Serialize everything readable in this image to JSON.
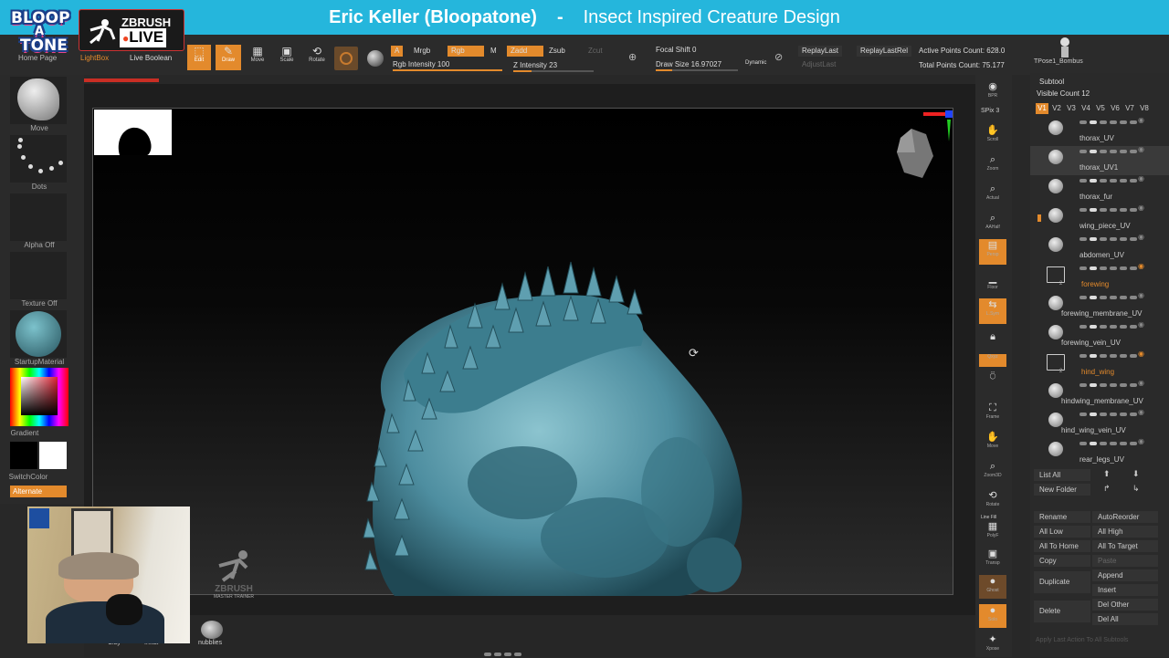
{
  "title": {
    "left": "Eric Keller (Bloopatone)",
    "separator": "-",
    "right": "Insect Inspired Creature Design"
  },
  "logo": {
    "line1": "BLOOP",
    "line2": "A",
    "line3": "TONE"
  },
  "zbrush_live": {
    "brand": "ZBRUSH",
    "live": "LIVE"
  },
  "top_tabs": {
    "home_page": "Home Page",
    "lightbox": "LightBox",
    "live_boolean": "Live Boolean"
  },
  "tools": {
    "edit": "Edit",
    "draw": "Draw",
    "move": "Move",
    "scale": "Scale",
    "rotate": "Rotate"
  },
  "brush_controls": {
    "a": "A",
    "mrgb": "Mrgb",
    "rgb": "Rgb",
    "m": "M",
    "zadd": "Zadd",
    "zsub": "Zsub",
    "zcut": "Zcut",
    "rgb_intensity": "Rgb Intensity 100",
    "z_intensity": "Z Intensity 23",
    "focal_shift": "Focal Shift 0",
    "draw_size": "Draw Size 16.97027",
    "dynamic": "Dynamic",
    "replay_last": "ReplayLast",
    "replay_last_rel": "ReplayLastRel",
    "adjust_last": "AdjustLast",
    "active_points": "Active Points Count: 628.0",
    "total_points": "Total Points Count: 75.177"
  },
  "left_shelf": {
    "move": "Move",
    "dots": "Dots",
    "alpha_off": "Alpha Off",
    "texture_off": "Texture Off",
    "material": "StartupMaterial",
    "gradient": "Gradient",
    "switch_color": "SwitchColor",
    "alternate": "Alternate"
  },
  "right_shelf": {
    "bpr": "BPR",
    "spix": "SPix 3",
    "scroll": "Scroll",
    "zoom": "Zoom",
    "actual": "Actual",
    "aahalf": "AAHalf",
    "persp": "Persp",
    "floor": "Floor",
    "lsym": "L.Sym",
    "xyz": "Qxyz",
    "frame": "Frame",
    "move": "Move",
    "zoom3d": "Zoom3D",
    "rotate": "Rotate",
    "linefill": "Line Fill",
    "polyf": "PolyF",
    "transp": "Transp",
    "ghost": "Ghost",
    "solo": "Solo",
    "xpose": "Xpose"
  },
  "subtool": {
    "tool_name": "TPose1_Bombus",
    "header": "Subtool",
    "visible_count": "Visible Count 12",
    "versions": [
      "V1",
      "V2",
      "V3",
      "V4",
      "V5",
      "V6",
      "V7",
      "V8"
    ],
    "items": [
      {
        "name": "thorax_UV"
      },
      {
        "name": "thorax_UV1"
      },
      {
        "name": "thorax_fur"
      },
      {
        "name": "wing_piece_UV"
      },
      {
        "name": "abdomen_UV"
      },
      {
        "name": "forewing",
        "folder": true,
        "count": "2"
      },
      {
        "name": "forewing_membrane_UV"
      },
      {
        "name": "forewing_vein_UV"
      },
      {
        "name": "hind_wing",
        "folder": true,
        "count": "2"
      },
      {
        "name": "hindwing_membrane_UV"
      },
      {
        "name": "hind_wing_vein_UV"
      },
      {
        "name": "rear_legs_UV"
      }
    ],
    "list_all": "List All",
    "new_folder": "New Folder",
    "rename": "Rename",
    "auto_reorder": "AutoReorder",
    "all_low": "All Low",
    "all_high": "All High",
    "all_to_home": "All To Home",
    "all_to_target": "All To Target",
    "copy": "Copy",
    "paste": "Paste",
    "duplicate": "Duplicate",
    "append": "Append",
    "insert": "Insert",
    "delete": "Delete",
    "del_other": "Del Other",
    "del_all": "Del All",
    "apply_last": "Apply Last Action To All Subtools"
  },
  "bottom": {
    "nubblies": "nubblies",
    "clay": "Clay",
    "inflat": "Inflat",
    "master_trainer": "MASTER TRAINER",
    "zbrush_wordmark": "ZBRUSH"
  },
  "colors": {
    "title_bar": "#25b6dc",
    "accent": "#e38a2c",
    "model": "#4e8ea0"
  }
}
